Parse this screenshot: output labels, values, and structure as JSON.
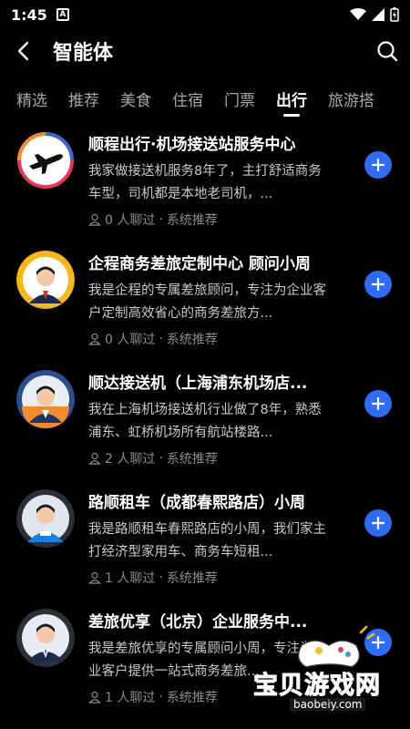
{
  "status": {
    "time": "1:45",
    "a_icon": "A"
  },
  "header": {
    "title": "智能体"
  },
  "tabs": [
    {
      "label": "精选"
    },
    {
      "label": "推荐"
    },
    {
      "label": "美食"
    },
    {
      "label": "住宿"
    },
    {
      "label": "门票"
    },
    {
      "label": "出行"
    },
    {
      "label": "旅游搭"
    }
  ],
  "active_tab": "出行",
  "agents": [
    {
      "title": "顺程出行·机场接送站服务中心",
      "desc": "我家做接送机服务8年了，主打舒适商务车型，司机都是本地老司机，...",
      "chats": "0 人聊过",
      "source": "系统推荐",
      "avatar_icon": "airplane-icon"
    },
    {
      "title": "企程商务差旅定制中心 顾问小周",
      "desc": "我是企程的专属差旅顾问，专注为企业客户定制高效省心的商务差旅方...",
      "chats": "0 人聊过",
      "source": "系统推荐",
      "avatar_icon": "person-icon"
    },
    {
      "title": "顺达接送机（上海浦东机场店...",
      "desc": "我在上海机场接送机行业做了8年，熟悉浦东、虹桥机场所有航站楼路...",
      "chats": "2 人聊过",
      "source": "系统推荐",
      "avatar_icon": "person-icon"
    },
    {
      "title": "路顺租车（成都春熙路店）小周",
      "desc": "我是路顺租车春熙路店的小周，我们家主打经济型家用车、商务车短租...",
      "chats": "1 人聊过",
      "source": "系统推荐",
      "avatar_icon": "person-icon"
    },
    {
      "title": "差旅优享（北京）企业服务中...",
      "desc": "我是差旅优享的专属顾问小周，专注为企业客户提供一站式商务差旅...",
      "chats": "1 人聊过",
      "source": "系统推荐",
      "avatar_icon": "person-icon"
    }
  ],
  "watermark": {
    "text": "宝贝游戏网",
    "url": "baobeiy.com"
  },
  "colors": {
    "accent": "#2f6bf4",
    "background": "#000000"
  }
}
